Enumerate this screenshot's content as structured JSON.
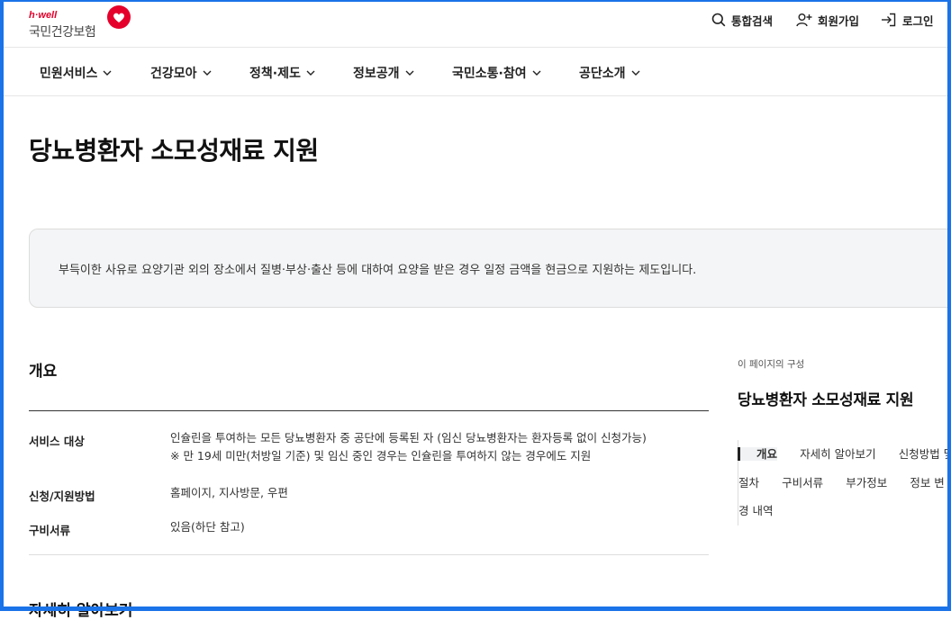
{
  "brand": {
    "tagline": "h·well",
    "name": "국민건강보험",
    "accent_color": "#e4002b"
  },
  "utility": {
    "search": {
      "label": "통합검색",
      "icon": "search-icon"
    },
    "signup": {
      "label": "회원가입",
      "icon": "user-plus-icon"
    },
    "login": {
      "label": "로그인",
      "icon": "login-icon"
    }
  },
  "gnb": [
    {
      "label": "민원서비스",
      "icon": "chevron-down-icon"
    },
    {
      "label": "건강모아",
      "icon": "chevron-down-icon"
    },
    {
      "label": "정책·제도",
      "icon": "chevron-down-icon"
    },
    {
      "label": "정보공개",
      "icon": "chevron-down-icon"
    },
    {
      "label": "국민소통·참여",
      "icon": "chevron-down-icon"
    },
    {
      "label": "공단소개",
      "icon": "chevron-down-icon"
    }
  ],
  "page": {
    "title": "당뇨병환자 소모성재료 지원",
    "summary": "부득이한 사유로 요양기관 외의 장소에서 질병·부상·출산 등에 대하여 요양을 받은 경우 일정 금액을 현금으로 지원하는 제도입니다."
  },
  "overview": {
    "title": "개요",
    "rows": [
      {
        "label": "서비스 대상",
        "lines": [
          "인슐린을 투여하는 모든 당뇨병환자 중 공단에 등록된 자 (임신 당뇨병환자는 환자등록 없이 신청가능)",
          "※ 만 19세 미만(처방일 기준) 및 임신 중인 경우는 인슐린을 투여하지 않는 경우에도 지원"
        ]
      },
      {
        "label": "신청/지원방법",
        "lines": [
          "홈페이지, 지사방문, 우편"
        ]
      },
      {
        "label": "구비서류",
        "lines": [
          "있음(하단 참고)"
        ]
      }
    ],
    "next_section_title": "자세히 알아보기"
  },
  "toc": {
    "caption": "이 페이지의 구성",
    "title": "당뇨병환자 소모성재료 지원",
    "items": [
      {
        "label": "개요",
        "active": true
      },
      {
        "label": "자세히 알아보기",
        "active": false
      },
      {
        "label": "신청방법 및 절차",
        "active": false
      },
      {
        "label": "구비서류",
        "active": false
      },
      {
        "label": "부가정보",
        "active": false
      },
      {
        "label": "정보 변경 내역",
        "active": false
      }
    ]
  }
}
